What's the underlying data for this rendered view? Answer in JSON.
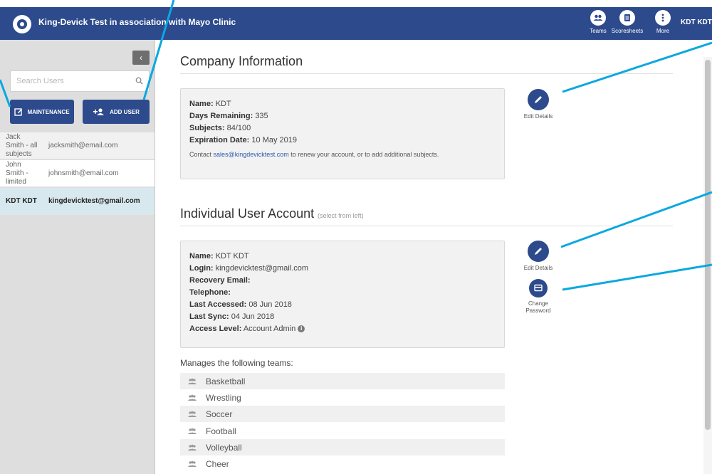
{
  "header": {
    "app_title": "King-Devick Test in association with Mayo Clinic",
    "nav": [
      {
        "label": "Teams",
        "icon": "teams-icon"
      },
      {
        "label": "Scoresheets",
        "icon": "scoresheets-icon"
      },
      {
        "label": "More",
        "icon": "more-icon"
      }
    ],
    "user_name": "KDT KDT"
  },
  "sidebar": {
    "collapse_icon": "chevron-left-icon",
    "search_placeholder": "Search Users",
    "maintenance_label": "MAINTENANCE",
    "add_user_label": "ADD USER",
    "users": [
      {
        "name": "Jack Smith - all subjects",
        "email": "jacksmith@email.com"
      },
      {
        "name": "John Smith - limited",
        "email": "johnsmith@email.com"
      },
      {
        "name": "KDT KDT",
        "email": "kingdevicktest@gmail.com"
      }
    ]
  },
  "company": {
    "title": "Company Information",
    "name_label": "Name:",
    "name": "KDT",
    "days_label": "Days Remaining:",
    "days": "335",
    "subjects_label": "Subjects:",
    "subjects": "84/100",
    "expiration_label": "Expiration Date:",
    "expiration": "10 May 2019",
    "contact_prefix": "Contact",
    "contact_email": "sales@kingdevicktest.com",
    "contact_suffix": "to renew your account, or to add additional subjects.",
    "edit_label": "Edit Details"
  },
  "account": {
    "title": "Individual User Account",
    "subtitle": "(select from left)",
    "name_label": "Name:",
    "name": "KDT KDT",
    "login_label": "Login:",
    "login": "kingdevicktest@gmail.com",
    "recovery_label": "Recovery Email:",
    "telephone_label": "Telephone:",
    "accessed_label": "Last Accessed:",
    "accessed": "08 Jun 2018",
    "sync_label": "Last Sync:",
    "sync": "04 Jun 2018",
    "access_label": "Access Level:",
    "access": "Account Admin",
    "info_glyph": "i",
    "edit_label": "Edit Details",
    "change_password_label": "Change Password"
  },
  "teams": {
    "title": "Manages the following teams:",
    "items": [
      "Basketball",
      "Wrestling",
      "Soccer",
      "Football",
      "Volleyball",
      "Cheer"
    ]
  },
  "colors": {
    "brand": "#2d4a8c",
    "callout": "#0aa8e0"
  }
}
